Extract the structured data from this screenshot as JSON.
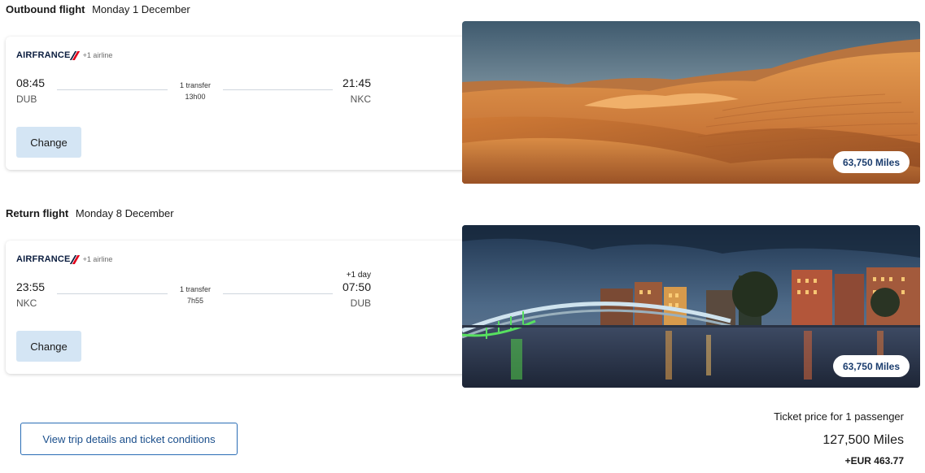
{
  "outbound": {
    "label": "Outbound flight",
    "date": "Monday 1 December",
    "airline": "AIRFRANCE",
    "extra_airline": "+1 airline",
    "departure_time": "08:45",
    "departure_code": "DUB",
    "arrival_time": "21:45",
    "arrival_code": "NKC",
    "transfer": "1 transfer",
    "duration": "13h00",
    "change_label": "Change",
    "miles": "63,750 Miles",
    "image_icon": "desert-dunes-photo"
  },
  "return": {
    "label": "Return flight",
    "date": "Monday 8 December",
    "airline": "AIRFRANCE",
    "extra_airline": "+1 airline",
    "departure_time": "23:55",
    "departure_code": "NKC",
    "arrival_time": "07:50",
    "arrival_code": "DUB",
    "plus_day": "+1 day",
    "transfer": "1 transfer",
    "duration": "7h55",
    "change_label": "Change",
    "miles": "63,750 Miles",
    "image_icon": "dublin-bridge-night-photo"
  },
  "details_button": "View trip details and ticket conditions",
  "price": {
    "label": "Ticket price for 1 passenger",
    "miles": "127,500 Miles",
    "eur": "+EUR 463.77"
  },
  "colors": {
    "accent": "#2a6db5",
    "button_bg": "#d4e5f4",
    "miles_text": "#1b3d6e",
    "airfrance_red": "#e2001a"
  }
}
